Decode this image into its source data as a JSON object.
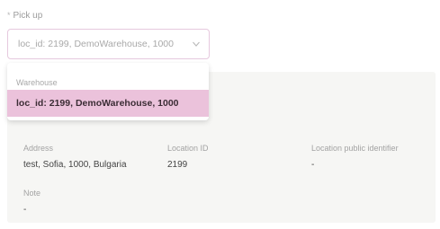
{
  "pickup": {
    "label": "Pick up",
    "required_mark": "*",
    "selected_value": "loc_id: 2199, DemoWarehouse, 1000"
  },
  "dropdown": {
    "group_label": "Warehouse",
    "options": [
      {
        "label": "loc_id: 2199, DemoWarehouse, 1000",
        "highlighted": true
      }
    ]
  },
  "details": {
    "address_label": "Address",
    "address_value": "test, Sofia, 1000, Bulgaria",
    "location_id_label": "Location ID",
    "location_id_value": "2199",
    "public_id_label": "Location public identifier",
    "public_id_value": "-",
    "note_label": "Note",
    "note_value": "-"
  },
  "colors": {
    "accent_border": "#e6c9de",
    "highlight": "#ebc2db",
    "panel_bg": "#f6f6f4"
  },
  "icons": {
    "select_chevron": "chevron-down-icon"
  }
}
